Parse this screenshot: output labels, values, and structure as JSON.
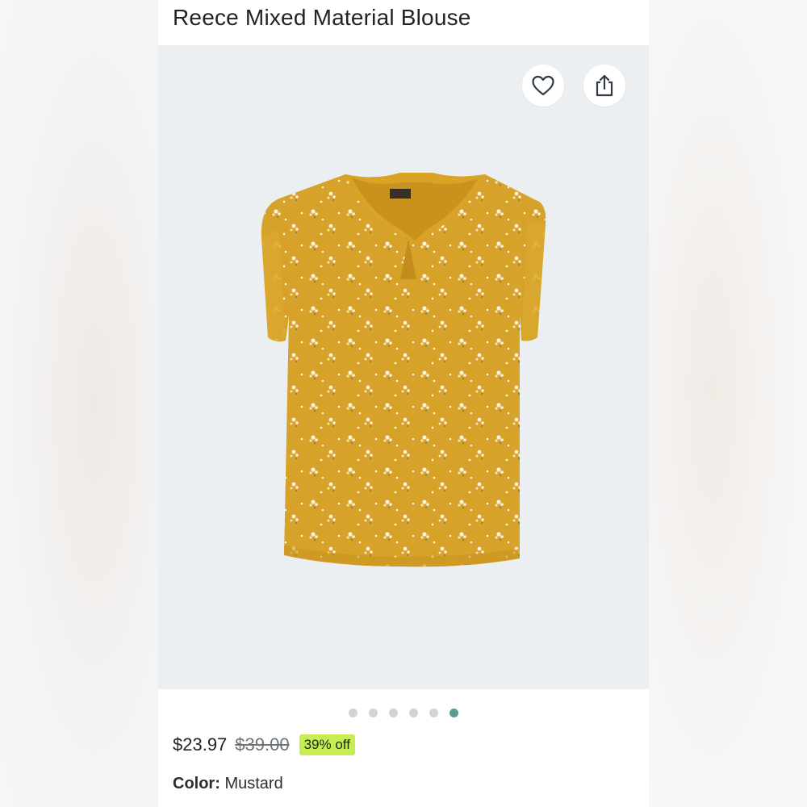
{
  "product": {
    "title": "Reece Mixed Material Blouse",
    "price": "$23.97",
    "original_price": "$39.00",
    "discount_label": "39% off",
    "color_label": "Color:",
    "color_value": "Mustard"
  },
  "gallery": {
    "image_count": 6,
    "active_index": 5,
    "garment_color": "#d7a22a",
    "background_color": "#eceff1"
  },
  "actions": {
    "favorite_icon": "heart-icon",
    "share_icon": "share-icon"
  },
  "colors": {
    "active_dot": "#5b9b90",
    "inactive_dot": "#cfd4d7",
    "discount_badge": "#c6ee53"
  }
}
